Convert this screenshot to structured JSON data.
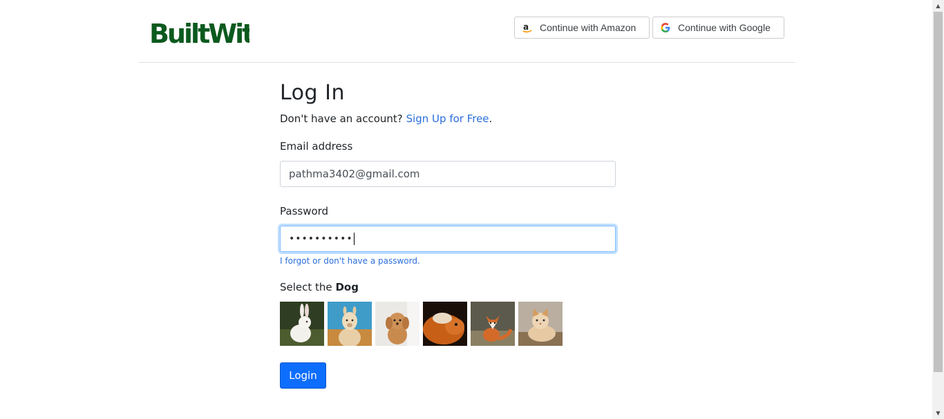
{
  "header": {
    "logo_text": "BuiltWith",
    "amazon_button": "Continue with Amazon",
    "google_button": "Continue with Google"
  },
  "colors": {
    "brand_green": "#0b5a1e",
    "link_blue": "#2a6edb",
    "primary_button": "#0d6efd"
  },
  "icons": {
    "amazon": "amazon-icon",
    "google": "google-icon"
  },
  "login": {
    "title": "Log In",
    "no_account_text": "Don't have an account?",
    "signup_link": "Sign Up for Free",
    "signup_suffix": ".",
    "email_label": "Email address",
    "email_value": "pathma3402@gmail.com",
    "password_label": "Password",
    "password_mask": "••••••••••",
    "forgot_link": "I forgot or don't have a password.",
    "captcha_prefix": "Select the",
    "captcha_animal": "Dog",
    "captcha_images": [
      "rabbit",
      "alpaca",
      "dog",
      "guinea-pig",
      "fox",
      "cat"
    ],
    "submit_label": "Login"
  }
}
